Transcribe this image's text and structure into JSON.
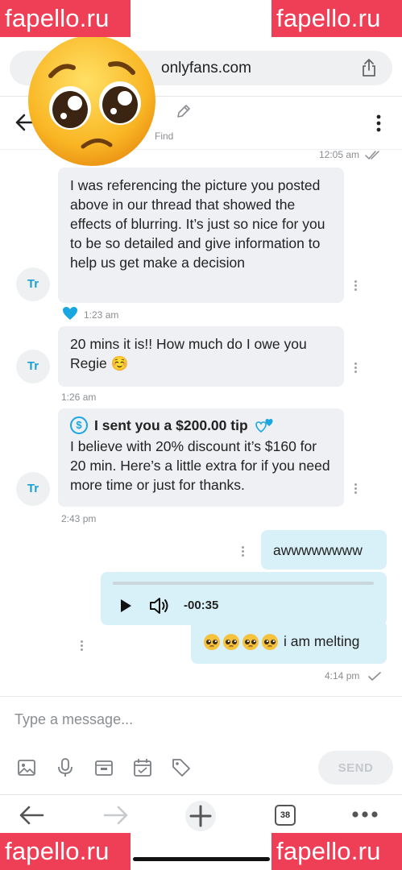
{
  "browser": {
    "url": "onlyfans.com",
    "tab_count": "38"
  },
  "header": {
    "find_label": "Find"
  },
  "messages": [
    {
      "time": "12:05 am"
    },
    {
      "text": "I was referencing the picture you posted above in our thread that showed the effects of blurring. It’s just so nice for you to be so detailed and give information to help us get make a decision",
      "avatar": "Tr",
      "time": "1:23 am"
    },
    {
      "text": "20 mins it is!! How much do I owe you Regie ☺️",
      "avatar": "Tr",
      "time": "1:26 am"
    },
    {
      "tip_title": "I sent you a $200.00 tip",
      "dollar_symbol": "$",
      "text": "I believe with 20% discount it’s $160 for 20 min. Here’s a little extra for if you need more time or just for thanks.",
      "avatar": "Tr",
      "time": "2:43 pm"
    },
    {
      "text": "awwwwwwww"
    },
    {
      "audio_duration": "-00:35",
      "text": "i am melting",
      "time": "4:14 pm"
    }
  ],
  "composer": {
    "placeholder": "Type a message...",
    "send_label": "SEND"
  },
  "watermark": "fapello.ru",
  "colors": {
    "accent": "#1aa6df",
    "watermark": "#ef3f57",
    "incoming_bubble": "#eef0f3",
    "outgoing_bubble": "#d8f0f8"
  }
}
